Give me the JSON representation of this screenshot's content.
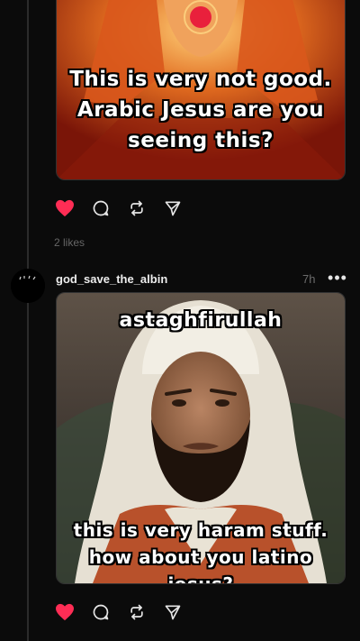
{
  "posts": [
    {
      "image_caption": "This is very not good.\nArabic Jesus are you\nseeing this?",
      "actions": [
        "like-icon",
        "comment-icon",
        "repost-icon",
        "share-icon"
      ],
      "likes_text": "2 likes",
      "like_color": "#ff2d55"
    },
    {
      "username": "god_save_the_albin",
      "timestamp": "7h",
      "more_label": "•••",
      "image_caption_top": "astaghfirullah",
      "image_caption_bottom": "this is very haram stuff.\nhow about you latino jesus?",
      "actions": [
        "like-icon",
        "comment-icon",
        "repost-icon",
        "share-icon"
      ],
      "like_color": "#ff2d55"
    }
  ]
}
